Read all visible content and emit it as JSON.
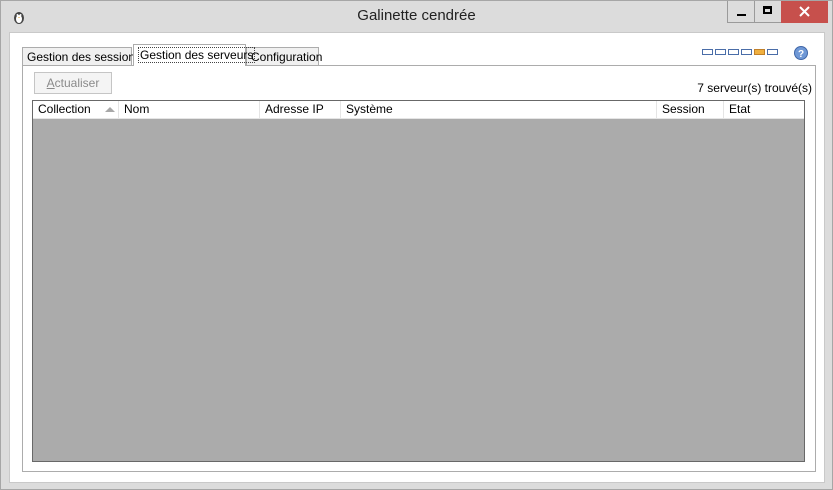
{
  "window": {
    "title": "Galinette cendrée"
  },
  "tabs": [
    {
      "label": "Gestion des sessions"
    },
    {
      "label": "Gestion des serveurs"
    },
    {
      "label": "Configuration"
    }
  ],
  "toolbar": {
    "refresh_label_accel": "A",
    "refresh_label_rest": "ctualiser",
    "server_count": "7 serveur(s) trouvé(s)"
  },
  "list": {
    "columns": [
      "Collection",
      "Nom",
      "Adresse IP",
      "Système",
      "Session",
      "Etat"
    ],
    "sort_column": "Collection",
    "rows": []
  },
  "icons": {
    "app": "penguin-icon",
    "help": "help-icon",
    "progress": "progress-indicator"
  },
  "colors": {
    "close_button": "#c7504c",
    "list_background": "#ababab",
    "progress_border": "#4a6da8"
  }
}
